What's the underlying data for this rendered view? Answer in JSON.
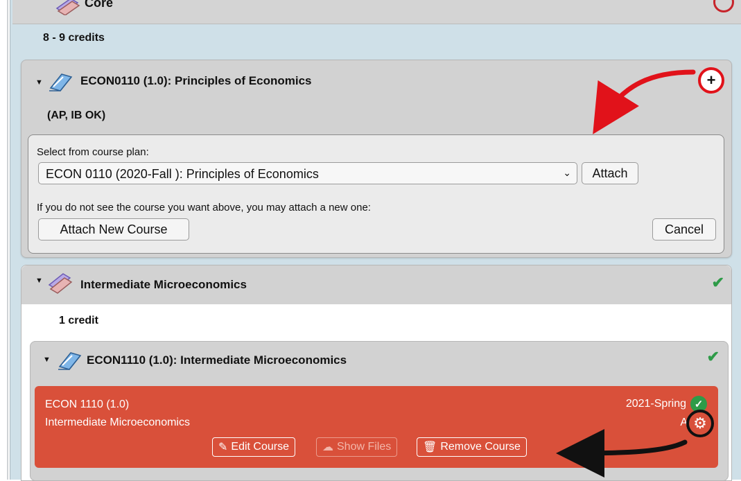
{
  "core": {
    "title": "Core",
    "credits": "8 - 9 credits"
  },
  "requirement": {
    "title": "ECON0110 (1.0): Principles of Economics",
    "note": "(AP, IB OK)",
    "attach_panel": {
      "label": "Select from course plan:",
      "selected_course": "ECON 0110 (2020-Fall ): Principles of Economics",
      "attach_label": "Attach",
      "hint": "If you do not see the course you want above, you may attach a new one:",
      "attach_new_label": "Attach New Course",
      "cancel_label": "Cancel"
    }
  },
  "group": {
    "title": "Intermediate Microeconomics",
    "credits": "1 credit",
    "course_requirement": {
      "title": "ECON1110 (1.0): Intermediate Microeconomics",
      "course": {
        "code": "ECON 1110 (1.0)",
        "name": "Intermediate Microeconomics",
        "term": "2021-Spring",
        "grade": "A",
        "edit_label": "Edit Course",
        "files_label": "Show Files",
        "remove_label": "Remove Course"
      }
    }
  },
  "colors": {
    "accent_red": "#d9503a",
    "check_green": "#2e9b48",
    "annotation_red": "#e1121a",
    "annotation_black": "#111111"
  },
  "icons": [
    "books-icon",
    "book-icon",
    "plus-icon",
    "check-icon",
    "gear-icon",
    "pencil-icon",
    "cloud-icon",
    "trash-icon",
    "chevron-down-icon"
  ]
}
